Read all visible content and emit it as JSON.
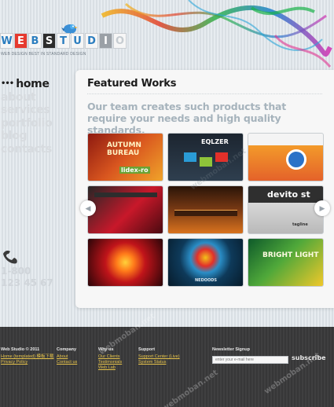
{
  "brand": {
    "letters": [
      "W",
      "E",
      "B",
      "S",
      "T",
      "U",
      "D",
      "I",
      "O"
    ],
    "letter_bg": [
      "#f6f6f6",
      "#e63a2f",
      "#f6f6f6",
      "#2c2c2c",
      "#f6f6f6",
      "#f6f6f6",
      "#f6f6f6",
      "#9aa0a6",
      "#f6f6f6"
    ],
    "letter_fg": [
      "#2b7dbf",
      "#ffffff",
      "#2b7dbf",
      "#ffffff",
      "#2b7dbf",
      "#2b7dbf",
      "#2b7dbf",
      "#ffffff",
      "#c6ccd1"
    ],
    "tagline": "WEB DESIGN BEST IN STANDARD DESIGN"
  },
  "nav": {
    "home_dots": "•••",
    "items": [
      "home",
      "about",
      "services",
      "portfolio",
      "blog",
      "contacts"
    ]
  },
  "phone": {
    "line1": "1-800",
    "line2": "123 45 67"
  },
  "featured": {
    "title": "Featured Works",
    "intro": "Our team creates such products that require your needs and high quality standards."
  },
  "thumbs": [
    {
      "caption": "AUTUMN BUREAU",
      "sub": "lidex-ro"
    },
    {
      "caption": "EQLZER",
      "sub": ""
    },
    {
      "caption": "",
      "sub": ""
    },
    {
      "caption": "",
      "sub": ""
    },
    {
      "caption": "",
      "sub": ""
    },
    {
      "caption": "devito st",
      "sub": "tagline"
    },
    {
      "caption": "",
      "sub": ""
    },
    {
      "caption": "NEDOODS",
      "sub": ""
    },
    {
      "caption": "BRIGHT LIGHT",
      "sub": ""
    }
  ],
  "footer": {
    "col1_title": "Web Studio © 2011",
    "col1_links": [
      "Home (templated) 模板下载",
      "Privacy Policy"
    ],
    "col2_title": "Company",
    "col2_links": [
      "About",
      "Contact us"
    ],
    "col3_title": "Why us",
    "col3_links": [
      "Our Clients",
      "Testimonials",
      "Web Lab"
    ],
    "col4_title": "Support",
    "col4_links": [
      "Support Center (Live)",
      "System Status"
    ],
    "newsletter_title": "Newsletter Signup",
    "newsletter_placeholder": "enter your e-mail here",
    "subscribe": "subscribe"
  },
  "watermark": "webmoban.net"
}
